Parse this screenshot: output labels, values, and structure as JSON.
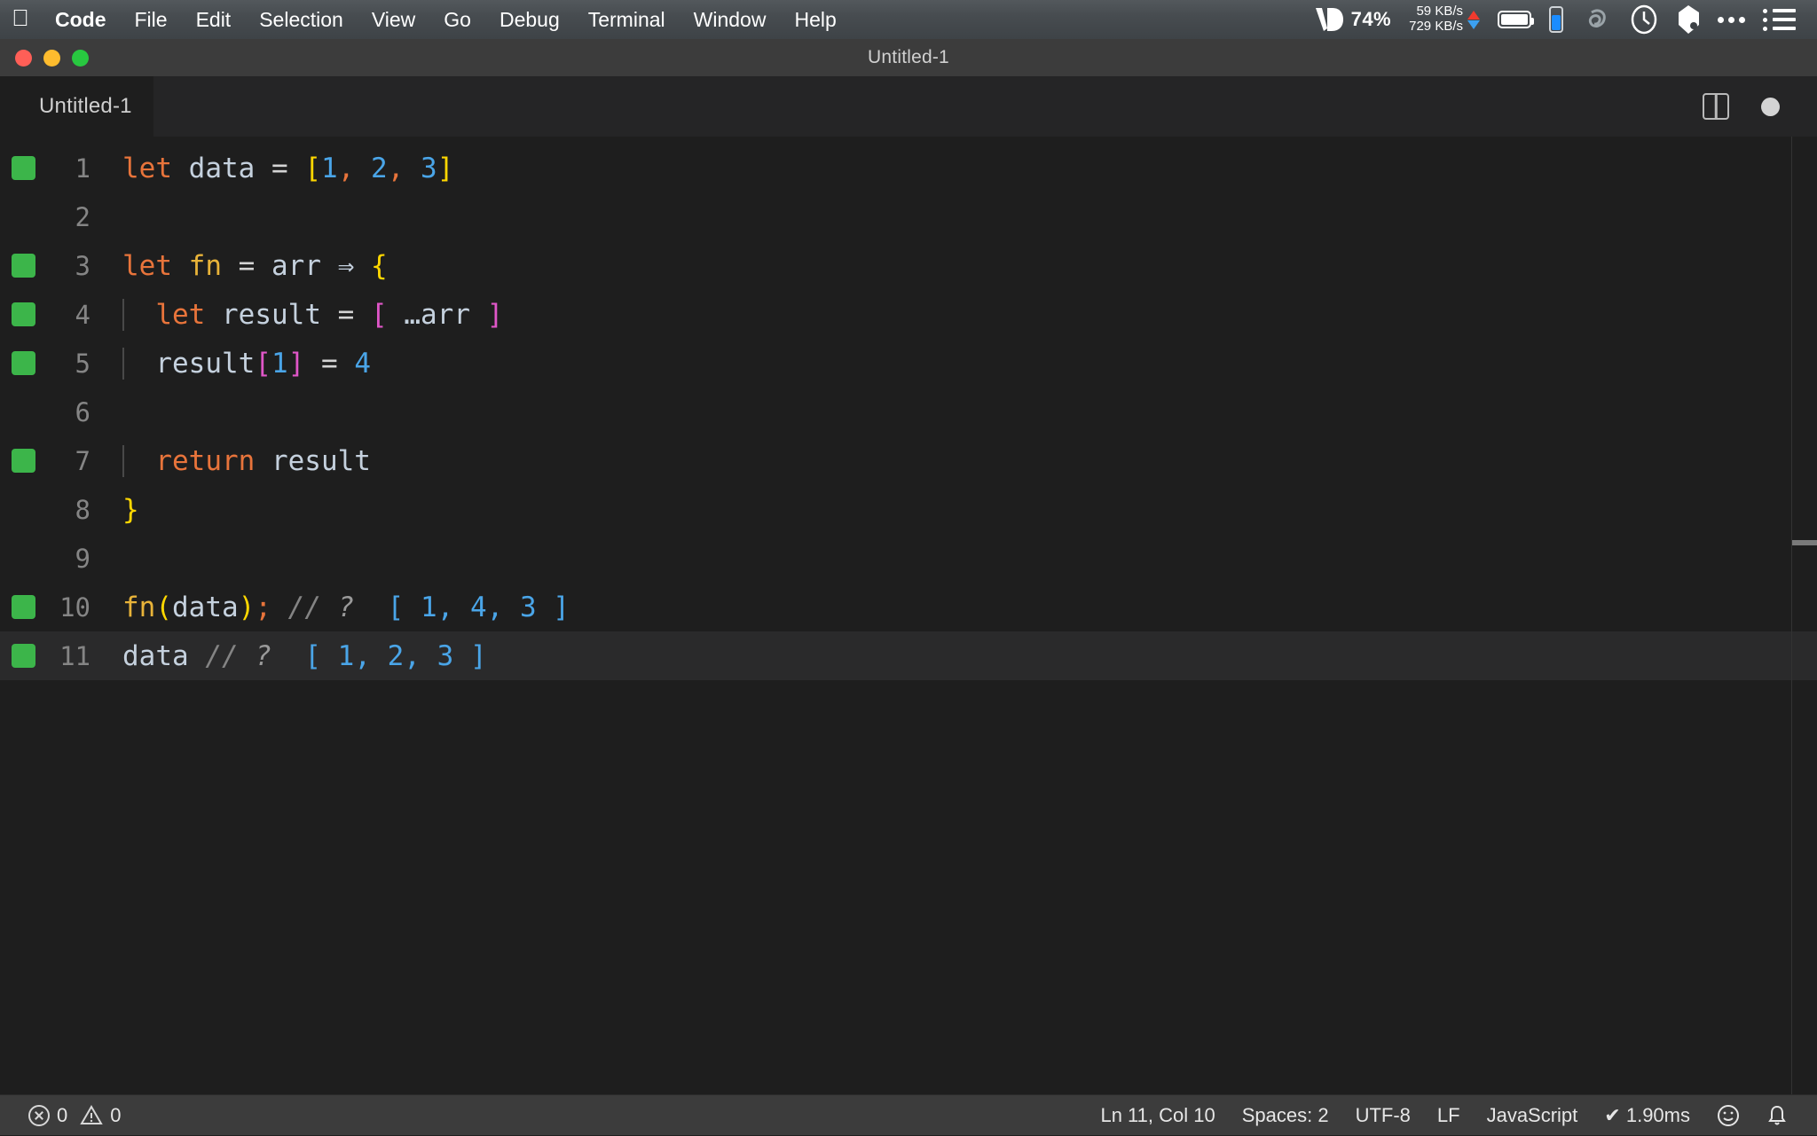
{
  "menubar": {
    "apple_icon": "apple-logo-icon",
    "items": [
      {
        "label": "Code",
        "bold": true
      },
      {
        "label": "File",
        "bold": false
      },
      {
        "label": "Edit",
        "bold": false
      },
      {
        "label": "Selection",
        "bold": false
      },
      {
        "label": "View",
        "bold": false
      },
      {
        "label": "Go",
        "bold": false
      },
      {
        "label": "Debug",
        "bold": false
      },
      {
        "label": "Terminal",
        "bold": false
      },
      {
        "label": "Window",
        "bold": false
      },
      {
        "label": "Help",
        "bold": false
      }
    ],
    "status": {
      "vd_percent": "74%",
      "net_up": "59 KB/s",
      "net_down": "729 KB/s",
      "battery_icon": "battery-icon",
      "phone_icon": "phone-icon",
      "loop_icon": "loop-icon",
      "clock_icon": "clock-icon",
      "dropbox_icon": "dropbox-icon",
      "overflow_icon": "ellipsis-icon",
      "controlcenter_icon": "list-icon"
    }
  },
  "window": {
    "title": "Untitled-1",
    "traffic": {
      "close": "close",
      "minimize": "minimize",
      "zoom": "zoom"
    }
  },
  "tabs": [
    {
      "label": "Untitled-1",
      "active": true,
      "dirty": true
    }
  ],
  "tab_actions": {
    "split_icon": "split-editor-icon",
    "dirty_icon": "unsaved-dot-icon"
  },
  "editor": {
    "language": "JavaScript",
    "active_line": 11,
    "lines": [
      {
        "n": "1",
        "breakpoint": true,
        "indent": 0,
        "active": false,
        "tokens": [
          {
            "t": "let",
            "c": "kw"
          },
          {
            "t": " ",
            "c": "var"
          },
          {
            "t": "data",
            "c": "var"
          },
          {
            "t": " ",
            "c": "var"
          },
          {
            "t": "=",
            "c": "op"
          },
          {
            "t": " ",
            "c": "var"
          },
          {
            "t": "[",
            "c": "b-yellow"
          },
          {
            "t": "1",
            "c": "num"
          },
          {
            "t": ",",
            "c": "comma"
          },
          {
            "t": " ",
            "c": "var"
          },
          {
            "t": "2",
            "c": "num"
          },
          {
            "t": ",",
            "c": "comma"
          },
          {
            "t": " ",
            "c": "var"
          },
          {
            "t": "3",
            "c": "num"
          },
          {
            "t": "]",
            "c": "b-yellow"
          }
        ]
      },
      {
        "n": "2",
        "breakpoint": false,
        "indent": 0,
        "active": false,
        "tokens": []
      },
      {
        "n": "3",
        "breakpoint": true,
        "indent": 0,
        "active": false,
        "tokens": [
          {
            "t": "let",
            "c": "kw"
          },
          {
            "t": " ",
            "c": "var"
          },
          {
            "t": "fn",
            "c": "fnname"
          },
          {
            "t": " ",
            "c": "var"
          },
          {
            "t": "=",
            "c": "op"
          },
          {
            "t": " ",
            "c": "var"
          },
          {
            "t": "arr",
            "c": "var"
          },
          {
            "t": " ",
            "c": "var"
          },
          {
            "t": "⇒",
            "c": "arrow"
          },
          {
            "t": " ",
            "c": "var"
          },
          {
            "t": "{",
            "c": "b-yellow"
          }
        ]
      },
      {
        "n": "4",
        "breakpoint": true,
        "indent": 1,
        "active": false,
        "tokens": [
          {
            "t": "  ",
            "c": "var"
          },
          {
            "t": "let",
            "c": "kw"
          },
          {
            "t": " ",
            "c": "var"
          },
          {
            "t": "result",
            "c": "var"
          },
          {
            "t": " ",
            "c": "var"
          },
          {
            "t": "=",
            "c": "op"
          },
          {
            "t": " ",
            "c": "var"
          },
          {
            "t": "[",
            "c": "b-pink"
          },
          {
            "t": " …",
            "c": "var"
          },
          {
            "t": "arr",
            "c": "var"
          },
          {
            "t": " ",
            "c": "var"
          },
          {
            "t": "]",
            "c": "b-pink"
          }
        ]
      },
      {
        "n": "5",
        "breakpoint": true,
        "indent": 1,
        "active": false,
        "tokens": [
          {
            "t": "  ",
            "c": "var"
          },
          {
            "t": "result",
            "c": "var"
          },
          {
            "t": "[",
            "c": "b-pink"
          },
          {
            "t": "1",
            "c": "num"
          },
          {
            "t": "]",
            "c": "b-pink"
          },
          {
            "t": " ",
            "c": "var"
          },
          {
            "t": "=",
            "c": "op"
          },
          {
            "t": " ",
            "c": "var"
          },
          {
            "t": "4",
            "c": "num"
          }
        ]
      },
      {
        "n": "6",
        "breakpoint": false,
        "indent": 1,
        "active": false,
        "tokens": []
      },
      {
        "n": "7",
        "breakpoint": true,
        "indent": 1,
        "active": false,
        "tokens": [
          {
            "t": "  ",
            "c": "var"
          },
          {
            "t": "return",
            "c": "kw"
          },
          {
            "t": " ",
            "c": "var"
          },
          {
            "t": "result",
            "c": "var"
          }
        ]
      },
      {
        "n": "8",
        "breakpoint": false,
        "indent": 0,
        "active": false,
        "tokens": [
          {
            "t": "}",
            "c": "b-yellow"
          }
        ]
      },
      {
        "n": "9",
        "breakpoint": false,
        "indent": 0,
        "active": false,
        "tokens": []
      },
      {
        "n": "10",
        "breakpoint": true,
        "indent": 0,
        "active": false,
        "tokens": [
          {
            "t": "fn",
            "c": "fnname"
          },
          {
            "t": "(",
            "c": "b-yellow"
          },
          {
            "t": "data",
            "c": "var"
          },
          {
            "t": ")",
            "c": "b-yellow"
          },
          {
            "t": ";",
            "c": "comma"
          },
          {
            "t": " ",
            "c": "var"
          },
          {
            "t": "//",
            "c": "comment"
          },
          {
            "t": " ",
            "c": "var"
          },
          {
            "t": "?",
            "c": "qmark"
          },
          {
            "t": "  ",
            "c": "var"
          },
          {
            "t": "[ 1, 4, 3 ]",
            "c": "result"
          }
        ]
      },
      {
        "n": "11",
        "breakpoint": true,
        "indent": 0,
        "active": true,
        "tokens": [
          {
            "t": "data",
            "c": "var"
          },
          {
            "t": " ",
            "c": "var"
          },
          {
            "t": "//",
            "c": "comment"
          },
          {
            "t": " ",
            "c": "var"
          },
          {
            "t": "?",
            "c": "qmark"
          },
          {
            "t": "  ",
            "c": "var"
          },
          {
            "t": "[ 1, 2, 3 ]",
            "c": "result"
          }
        ]
      }
    ]
  },
  "statusbar": {
    "errors_icon": "error-circle-icon",
    "errors": "0",
    "warnings_icon": "warning-triangle-icon",
    "warnings": "0",
    "cursor": "Ln 11, Col 10",
    "indentation": "Spaces: 2",
    "encoding": "UTF-8",
    "eol": "LF",
    "language": "JavaScript",
    "quokka": "✔ 1.90ms",
    "feedback_icon": "smiley-icon",
    "notifications_icon": "bell-icon"
  },
  "colors": {
    "editor_bg": "#1e1e1e",
    "sidebar_bg": "#252526",
    "titlebar_bg": "#3c3c3c",
    "statusbar_bg": "#3c3c3c",
    "keyword": "#e8743b",
    "function": "#e8b339",
    "number": "#4aa5e8",
    "bracket_yellow": "#ffd700",
    "bracket_pink": "#e056c8",
    "comment": "#848484",
    "breakpoint_green": "#3cb54a"
  }
}
